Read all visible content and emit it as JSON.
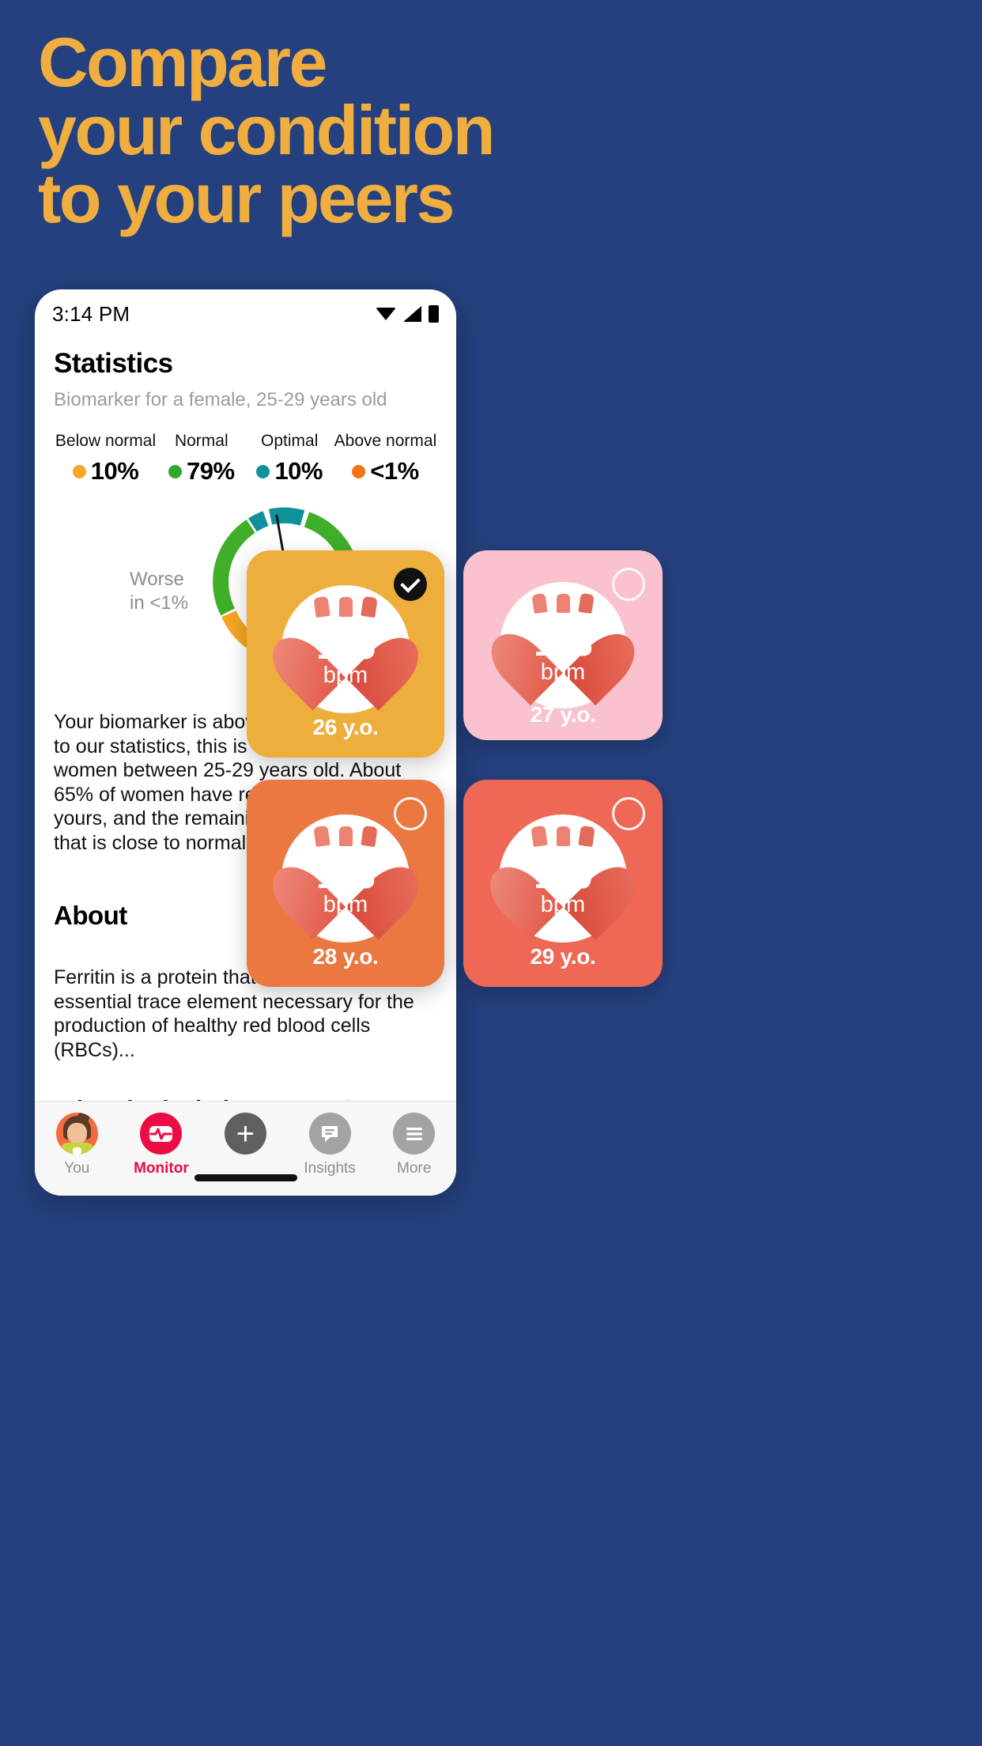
{
  "headline": {
    "lines": [
      "Compare",
      "your condition",
      "to your peers"
    ],
    "color": "#EFAE3F",
    "background": "#25407E"
  },
  "phone": {
    "statusbar": {
      "time": "3:14 PM",
      "icons": [
        "wifi-icon",
        "signal-icon",
        "battery-icon"
      ]
    },
    "page_title": "Statistics",
    "page_subtitle": "Biomarker for a female, 25-29 years old",
    "legend": [
      {
        "label": "Below normal",
        "value": "10%",
        "color": "#F5A623"
      },
      {
        "label": "Normal",
        "value": "79%",
        "color": "#2FAA2C"
      },
      {
        "label": "Optimal",
        "value": "10%",
        "color": "#0E9199"
      },
      {
        "label": "Above normal",
        "value": "<1%",
        "color": "#F97316"
      }
    ],
    "gauge": {
      "worse_label": "Worse\nin <1%",
      "needle_angle_deg": -10
    },
    "paragraph": "Your biomarker is above normal. According to our statistics, this is observed in <1% of women between 25-29 years old. About 65% of women have results higher than yours, and the remaining 35% have a level that is close to normal.",
    "about_heading": "About",
    "about_text": "Ferritin is a protein that contains iron — an essential trace element necessary for the production of healthy red blood cells (RBCs)...",
    "deviations_heading": "What do deviations mean?",
    "bottom_nav": [
      {
        "label": "You",
        "icon": "avatar-icon",
        "active": false
      },
      {
        "label": "Monitor",
        "icon": "pulse-icon",
        "active": true
      },
      {
        "label": "",
        "icon": "plus-icon",
        "active": false
      },
      {
        "label": "Insights",
        "icon": "chat-icon",
        "active": false
      },
      {
        "label": "More",
        "icon": "menu-icon",
        "active": false
      }
    ],
    "active_nav_color": "#EC0B43"
  },
  "cards": [
    {
      "bpm": "185",
      "unit": "bpm",
      "age": "26 y.o.",
      "bg": "#EEAE3C",
      "selected": true
    },
    {
      "bpm": "183",
      "unit": "bpm",
      "age": "27 y.o.",
      "bg": "#F9C2CE",
      "selected": false
    },
    {
      "bpm": "183",
      "unit": "bpm",
      "age": "28 y.o.",
      "bg": "#EA7840",
      "selected": false
    },
    {
      "bpm": "180",
      "unit": "bpm",
      "age": "29 y.o.",
      "bg": "#EE6855",
      "selected": false
    }
  ],
  "chart_data": {
    "type": "pie",
    "title": "Statistics",
    "subtitle": "Biomarker for a female, 25-29 years old",
    "categories": [
      "Below normal",
      "Normal",
      "Optimal",
      "Above normal"
    ],
    "values": [
      10,
      79,
      10,
      0.5
    ],
    "value_labels": [
      "10%",
      "79%",
      "10%",
      "<1%"
    ],
    "colors": [
      "#F5A623",
      "#2FAA2C",
      "#0E9199",
      "#F97316"
    ],
    "annotation": "Worse in <1%",
    "legend": "top",
    "gauge_style": "donut-arc"
  }
}
